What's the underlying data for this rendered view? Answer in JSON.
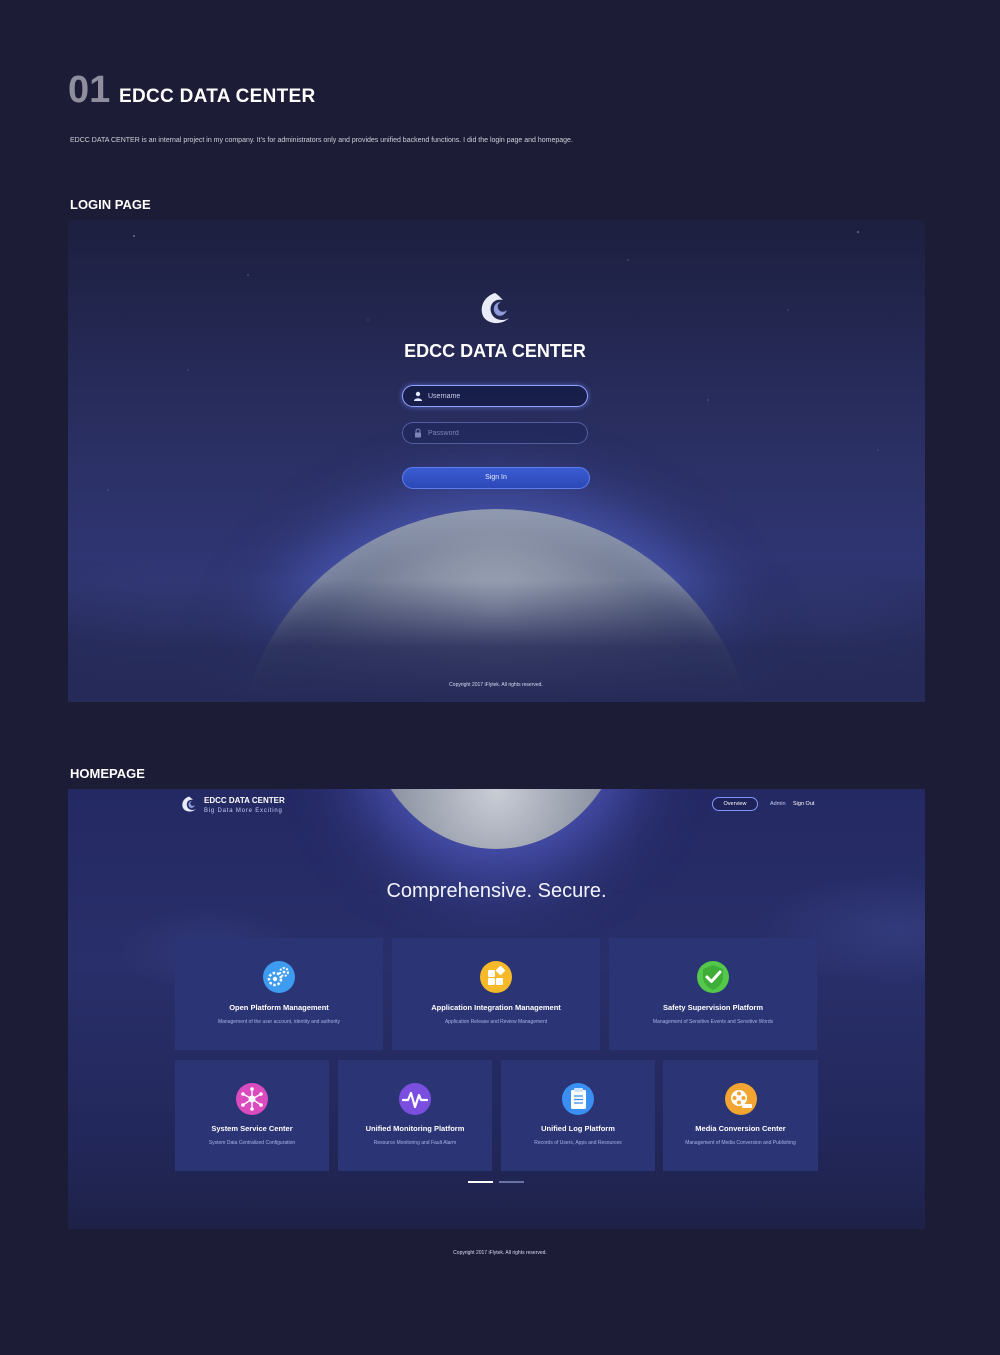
{
  "header": {
    "number": "01",
    "title": "EDCC DATA CENTER",
    "description": "EDCC DATA CENTER is  an internal project in my company. It's for administrators only and provides unified backend functions. I did the login page and homepage."
  },
  "login_section": {
    "label": "LOGIN PAGE",
    "app_title": "EDCC DATA CENTER",
    "username_placeholder": "Username",
    "password_placeholder": "Password",
    "signin_label": "Sign In",
    "copyright": "Copyright 2017 iFlytek. All rights reserved."
  },
  "home_section": {
    "label": "HOMEPAGE",
    "brand": "EDCC DATA CENTER",
    "brand_tagline": "Big Data More Exciting",
    "nav": {
      "overview": "Overview",
      "admin": "Admin",
      "sign_out": "Sign Out"
    },
    "tagline": "Comprehensive. Secure.",
    "cards_row1": [
      {
        "title": "Open Platform Management",
        "subtitle": "Management of the user account, identity and authority",
        "icon": "gears-icon"
      },
      {
        "title": "Application Integration Management",
        "subtitle": "Application Release and Review Management",
        "icon": "app-blocks-icon"
      },
      {
        "title": "Safety Supervision Platform",
        "subtitle": "Management of Sensitive Events and Sensitive Words",
        "icon": "shield-check-icon"
      }
    ],
    "cards_row2": [
      {
        "title": "System Service Center",
        "subtitle": "System Data Centralized Configuration",
        "icon": "network-icon"
      },
      {
        "title": "Unified Monitoring Platform",
        "subtitle": "Resource Monitoring and Fault Alarm",
        "icon": "pulse-icon"
      },
      {
        "title": "Unified Log Platform",
        "subtitle": "Records of Users, Apps and Resources",
        "icon": "clipboard-icon"
      },
      {
        "title": "Media Conversion Center",
        "subtitle": "Management of Media Conversion and Publishing",
        "icon": "film-reel-icon"
      }
    ],
    "copyright": "Copyright 2017 iFlytek. All rights reserved."
  },
  "colors": {
    "page_bg": "#1c1c36",
    "card_bg": "#2b3475",
    "accent": "#3a5bd2"
  }
}
